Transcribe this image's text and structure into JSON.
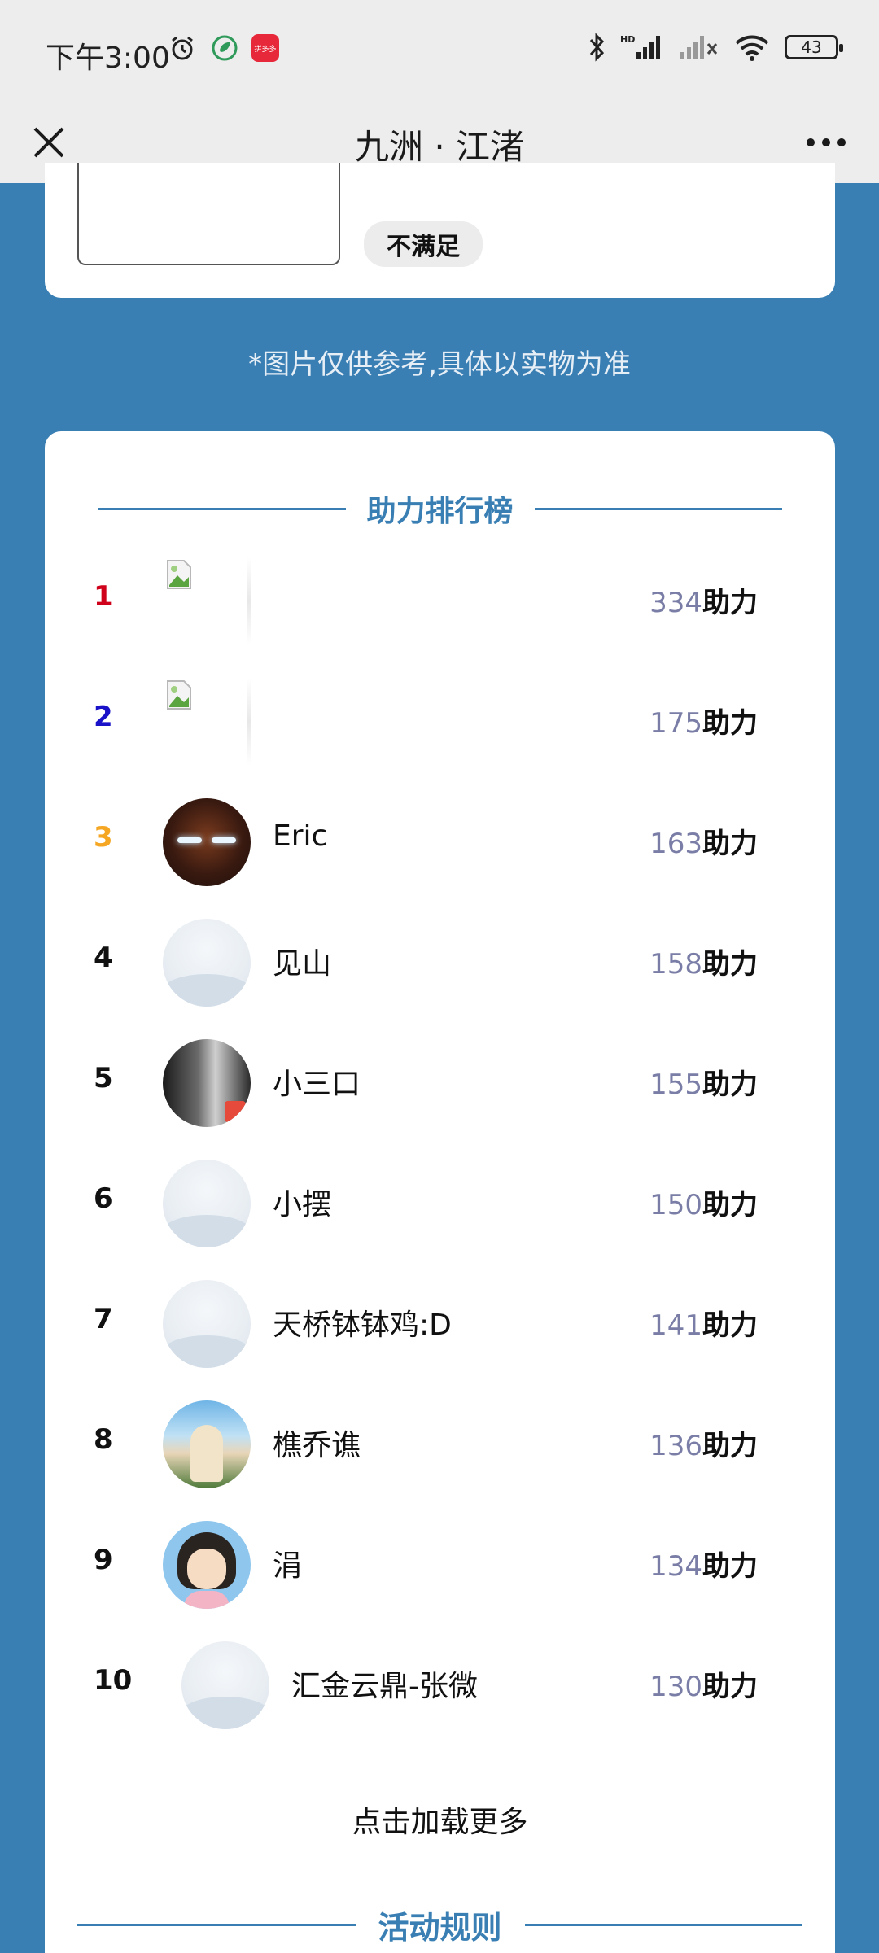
{
  "status_bar": {
    "time": "下午3:00",
    "app_badge": "拼多多",
    "battery": "43"
  },
  "nav": {
    "title": "九洲 · 江渚"
  },
  "top_card": {
    "pill_label": "不满足"
  },
  "disclaimer": "*图片仅供参考,具体以实物为准",
  "ranking": {
    "title": "助力排行榜",
    "unit": "助力",
    "rows": [
      {
        "rank": "1",
        "name": "",
        "score": "334",
        "rank_color": "#d0021b"
      },
      {
        "rank": "2",
        "name": "",
        "score": "175",
        "rank_color": "#1a12c8"
      },
      {
        "rank": "3",
        "name": "Eric",
        "score": "163",
        "rank_color": "#f5a623"
      },
      {
        "rank": "4",
        "name": "见山",
        "score": "158",
        "rank_color": "#111111"
      },
      {
        "rank": "5",
        "name": "小三口",
        "score": "155",
        "rank_color": "#111111"
      },
      {
        "rank": "6",
        "name": "小摆",
        "score": "150",
        "rank_color": "#111111"
      },
      {
        "rank": "7",
        "name": "天桥钵钵鸡:D",
        "score": "141",
        "rank_color": "#111111"
      },
      {
        "rank": "8",
        "name": "樵乔谯",
        "score": "136",
        "rank_color": "#111111"
      },
      {
        "rank": "9",
        "name": "涓",
        "score": "134",
        "rank_color": "#111111"
      },
      {
        "rank": "10",
        "name": "汇金云鼎-张微",
        "score": "130",
        "rank_color": "#111111"
      }
    ],
    "load_more": "点击加载更多"
  },
  "rules": {
    "title": "活动规则"
  },
  "colors": {
    "page_background": "#3a7fb3",
    "accent": "#3a7fb3",
    "score_number": "#7a7ea6"
  }
}
